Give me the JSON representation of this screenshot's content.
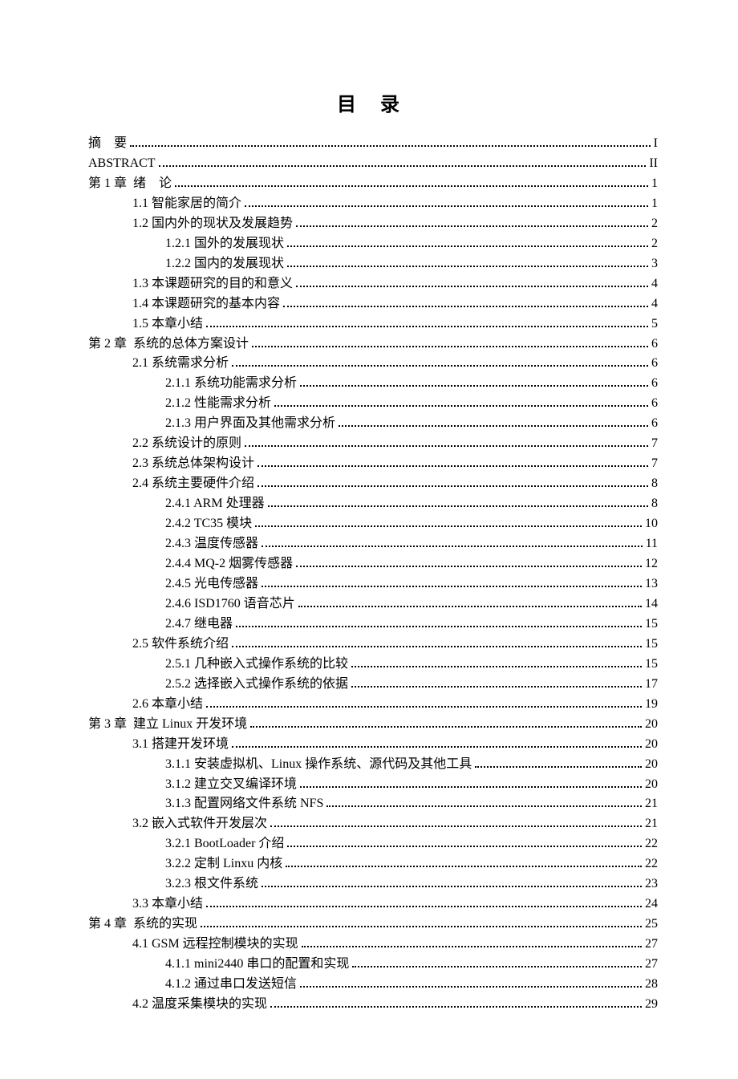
{
  "title": "目 录",
  "entries": [
    {
      "level": 0,
      "text": "摘　要",
      "page": "I"
    },
    {
      "level": 0,
      "text": "ABSTRACT",
      "page": "II"
    },
    {
      "level": 0,
      "text": "第 1 章  绪　论",
      "page": "1"
    },
    {
      "level": 1,
      "text": "1.1 智能家居的简介",
      "page": "1"
    },
    {
      "level": 1,
      "text": "1.2 国内外的现状及发展趋势",
      "page": "2"
    },
    {
      "level": 2,
      "text": "1.2.1 国外的发展现状",
      "page": "2"
    },
    {
      "level": 2,
      "text": "1.2.2 国内的发展现状",
      "page": "3"
    },
    {
      "level": 1,
      "text": "1.3 本课题研究的目的和意义",
      "page": "4"
    },
    {
      "level": 1,
      "text": "1.4 本课题研究的基本内容",
      "page": "4"
    },
    {
      "level": 1,
      "text": "1.5 本章小结",
      "page": "5"
    },
    {
      "level": 0,
      "text": "第 2 章  系统的总体方案设计",
      "page": "6"
    },
    {
      "level": 1,
      "text": "2.1 系统需求分析",
      "page": "6"
    },
    {
      "level": 2,
      "text": "2.1.1 系统功能需求分析",
      "page": "6"
    },
    {
      "level": 2,
      "text": "2.1.2 性能需求分析",
      "page": "6"
    },
    {
      "level": 2,
      "text": "2.1.3 用户界面及其他需求分析",
      "page": "6"
    },
    {
      "level": 1,
      "text": "2.2 系统设计的原则",
      "page": "7"
    },
    {
      "level": 1,
      "text": "2.3 系统总体架构设计",
      "page": "7"
    },
    {
      "level": 1,
      "text": "2.4 系统主要硬件介绍",
      "page": "8"
    },
    {
      "level": 2,
      "text": "2.4.1 ARM 处理器",
      "page": "8"
    },
    {
      "level": 2,
      "text": "2.4.2 TC35 模块",
      "page": "10"
    },
    {
      "level": 2,
      "text": "2.4.3 温度传感器",
      "page": "11"
    },
    {
      "level": 2,
      "text": "2.4.4 MQ-2 烟雾传感器",
      "page": "12"
    },
    {
      "level": 2,
      "text": "2.4.5 光电传感器",
      "page": "13"
    },
    {
      "level": 2,
      "text": "2.4.6 ISD1760 语音芯片",
      "page": "14"
    },
    {
      "level": 2,
      "text": "2.4.7 继电器",
      "page": "15"
    },
    {
      "level": 1,
      "text": "2.5 软件系统介绍",
      "page": "15"
    },
    {
      "level": 2,
      "text": "2.5.1 几种嵌入式操作系统的比较",
      "page": "15"
    },
    {
      "level": 2,
      "text": "2.5.2 选择嵌入式操作系统的依据",
      "page": "17"
    },
    {
      "level": 1,
      "text": "2.6 本章小结",
      "page": "19"
    },
    {
      "level": 0,
      "text": "第 3 章  建立 Linux 开发环境",
      "page": "20"
    },
    {
      "level": 1,
      "text": "3.1 搭建开发环境",
      "page": "20"
    },
    {
      "level": 2,
      "text": "3.1.1 安装虚拟机、Linux 操作系统、源代码及其他工具",
      "page": "20"
    },
    {
      "level": 2,
      "text": "3.1.2 建立交叉编译环境",
      "page": "20"
    },
    {
      "level": 2,
      "text": "3.1.3 配置网络文件系统 NFS",
      "page": "21"
    },
    {
      "level": 1,
      "text": "3.2 嵌入式软件开发层次",
      "page": "21"
    },
    {
      "level": 2,
      "text": "3.2.1 BootLoader 介绍",
      "page": "22"
    },
    {
      "level": 2,
      "text": "3.2.2 定制 Linxu 内核",
      "page": "22"
    },
    {
      "level": 2,
      "text": "3.2.3 根文件系统",
      "page": "23"
    },
    {
      "level": 1,
      "text": "3.3 本章小结",
      "page": "24"
    },
    {
      "level": 0,
      "text": "第 4 章  系统的实现",
      "page": "25"
    },
    {
      "level": 1,
      "text": "4.1 GSM 远程控制模块的实现",
      "page": "27"
    },
    {
      "level": 2,
      "text": "4.1.1 mini2440 串口的配置和实现",
      "page": "27"
    },
    {
      "level": 2,
      "text": "4.1.2 通过串口发送短信",
      "page": "28"
    },
    {
      "level": 1,
      "text": "4.2 温度采集模块的实现",
      "page": "29"
    }
  ]
}
